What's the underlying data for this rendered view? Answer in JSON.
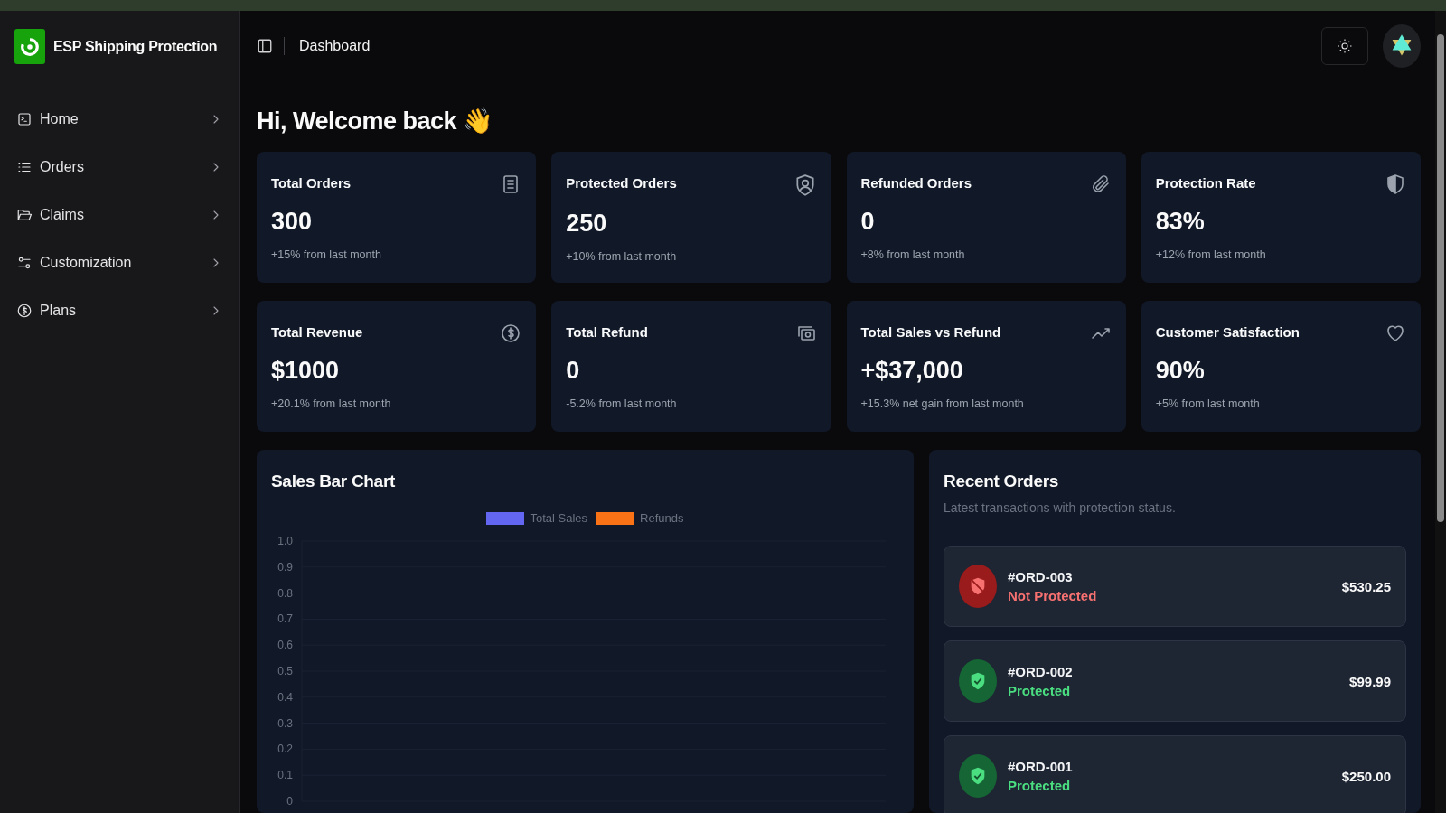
{
  "sidebar": {
    "brand": "ESP Shipping Protection",
    "items": [
      {
        "label": "Home"
      },
      {
        "label": "Orders"
      },
      {
        "label": "Claims"
      },
      {
        "label": "Customization"
      },
      {
        "label": "Plans"
      }
    ]
  },
  "header": {
    "breadcrumb": "Dashboard"
  },
  "greeting": "Hi, Welcome back 👋",
  "stats": [
    {
      "title": "Total Orders",
      "value": "300",
      "note": "+15% from last month"
    },
    {
      "title": "Protected Orders",
      "value": "250",
      "note": "+10% from last month"
    },
    {
      "title": "Refunded Orders",
      "value": "0",
      "note": "+8% from last month"
    },
    {
      "title": "Protection Rate",
      "value": "83%",
      "note": "+12% from last month"
    },
    {
      "title": "Total Revenue",
      "value": "$1000",
      "note": "+20.1% from last month"
    },
    {
      "title": "Total Refund",
      "value": "0",
      "note": "-5.2% from last month"
    },
    {
      "title": "Total Sales vs Refund",
      "value": "+$37,000",
      "note": "+15.3% net gain from last month"
    },
    {
      "title": "Customer Satisfaction",
      "value": "90%",
      "note": "+5% from last month"
    }
  ],
  "sales_chart": {
    "title": "Sales Bar Chart",
    "chart_data": {
      "type": "bar",
      "series": [
        {
          "name": "Total Sales",
          "color": "#6366f1"
        },
        {
          "name": "Refunds",
          "color": "#f97316"
        }
      ],
      "ylim": [
        0,
        1
      ],
      "yticks": [
        0,
        0.1,
        0.2,
        0.3,
        0.4,
        0.5,
        0.6,
        0.7,
        0.8,
        0.9,
        {
          "value": 1,
          "label": "1.0"
        }
      ],
      "grid": true
    }
  },
  "recent_orders": {
    "title": "Recent Orders",
    "subtitle": "Latest transactions with protection status.",
    "orders": [
      {
        "id": "#ORD-003",
        "status": "Not Protected",
        "protected": false,
        "amount": "$530.25"
      },
      {
        "id": "#ORD-002",
        "status": "Protected",
        "protected": true,
        "amount": "$99.99"
      },
      {
        "id": "#ORD-001",
        "status": "Protected",
        "protected": true,
        "amount": "$250.00"
      }
    ]
  }
}
